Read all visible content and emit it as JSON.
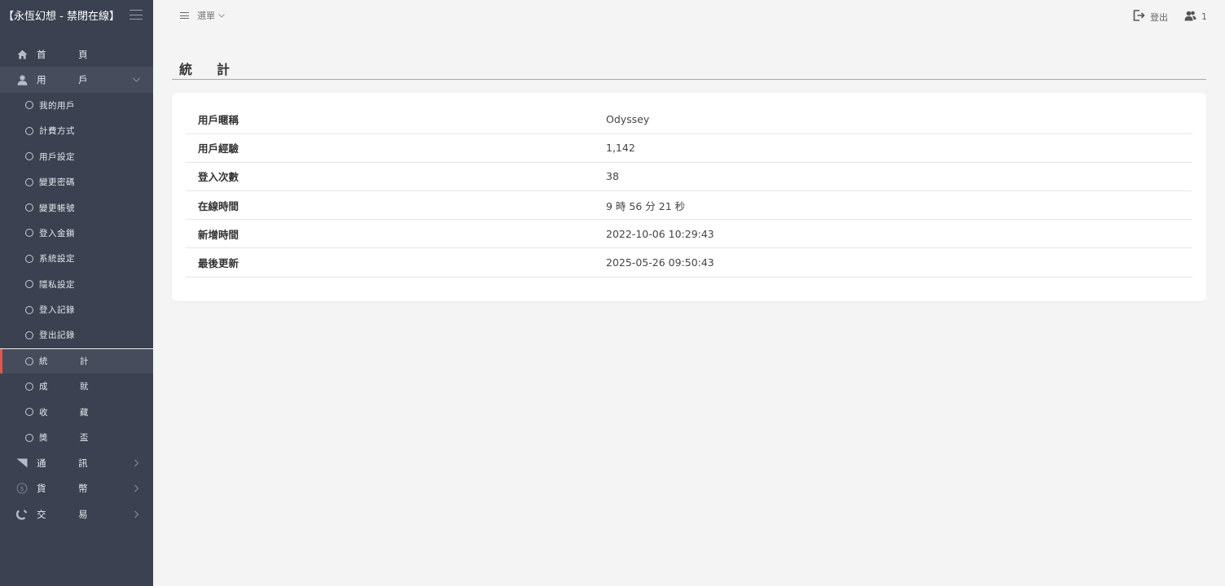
{
  "brand": {
    "title": "【永恆幻想 - 禁閉在線】"
  },
  "sidebar": {
    "home": "首 頁",
    "user": "用 戶",
    "sub_items": [
      "我的用戶",
      "計費方式",
      "用戶設定",
      "變更密碼",
      "變更帳號",
      "登入金鎖",
      "系統設定",
      "隱私設定",
      "登入記錄",
      "登出記錄"
    ],
    "active_item": "統 計",
    "sub_items_after": [
      "成 就",
      "收 藏",
      "獎 盃"
    ],
    "notice": "通 訊",
    "currency": "貨 幣",
    "trade": "交 易"
  },
  "header": {
    "menu_label": "選單",
    "logout_label": "登出",
    "online_count": "1"
  },
  "page": {
    "title": "統計"
  },
  "stats": {
    "rows": [
      {
        "key": "用戶暱稱",
        "value": "Odyssey"
      },
      {
        "key": "用戶經驗",
        "value": "1,142"
      },
      {
        "key": "登入次數",
        "value": "38"
      },
      {
        "key": "在線時間",
        "value": "9 時 56 分 21 秒"
      },
      {
        "key": "新增時間",
        "value": "2022-10-06 10:29:43"
      },
      {
        "key": "最後更新",
        "value": "2025-05-26 09:50:43"
      }
    ]
  },
  "colors": {
    "sidebar_bg": "#3b4150",
    "active_accent": "#e8534a",
    "page_bg": "#f4f4f4"
  },
  "icons": {
    "home": "home-icon",
    "user": "user-icon",
    "notice": "megaphone-icon",
    "currency": "coin-icon",
    "trade": "magnet-icon",
    "logout": "logout-icon",
    "users": "users-icon"
  }
}
